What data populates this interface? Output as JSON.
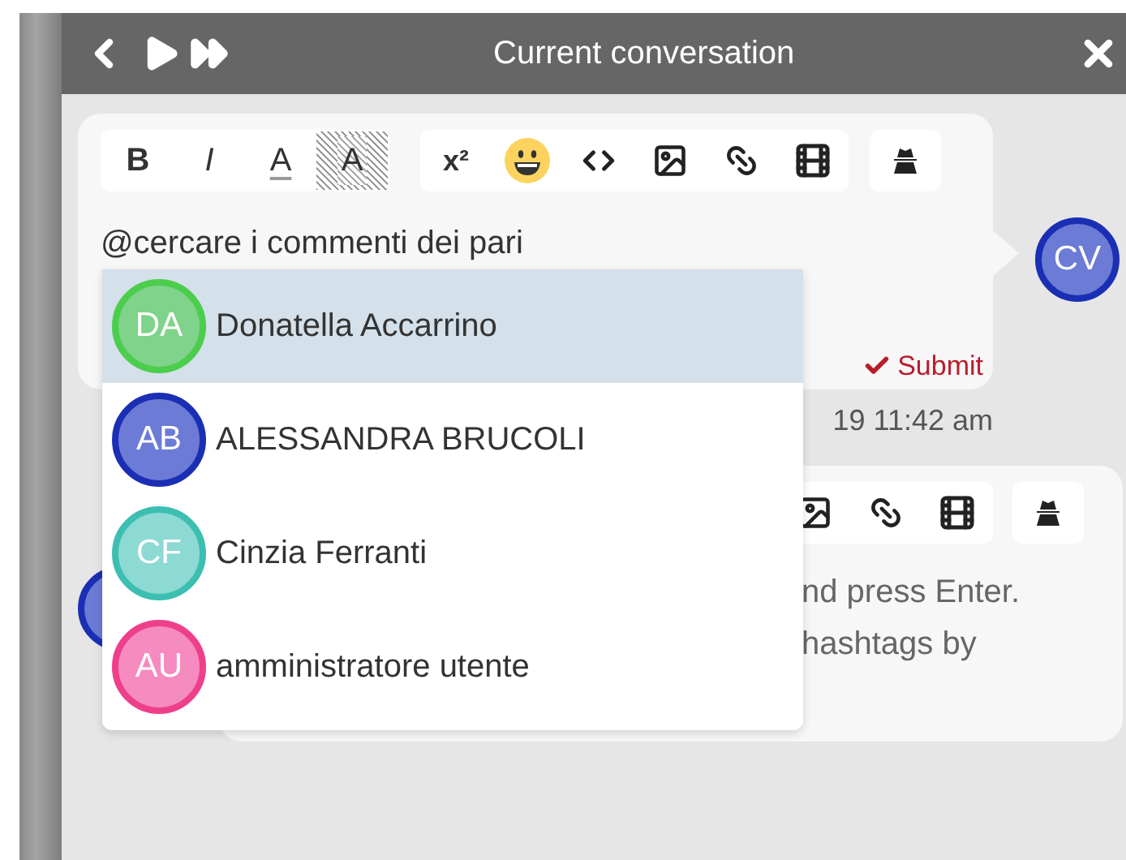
{
  "header": {
    "title": "Current conversation"
  },
  "composer": {
    "format_buttons": [
      {
        "label": "B",
        "kind": "bold"
      },
      {
        "label": "I",
        "kind": "italic"
      },
      {
        "label": "A",
        "kind": "color"
      },
      {
        "label": "A",
        "kind": "highlight"
      }
    ],
    "insert_buttons": [
      {
        "label": "x²",
        "kind": "text"
      },
      {
        "kind": "emoji"
      },
      {
        "kind": "code"
      },
      {
        "kind": "image"
      },
      {
        "kind": "link"
      },
      {
        "kind": "film"
      }
    ],
    "text": "@cercare i commenti dei pari",
    "submit": "Submit",
    "avatar": {
      "initials": "CV",
      "color": "#6b7bd6"
    }
  },
  "timestamp": "19 11:42 am",
  "second_card": {
    "lines": [
      "nd press Enter.",
      "hashtags by"
    ],
    "avatar": {
      "color": "#6b7bd6"
    }
  },
  "mentions": [
    {
      "initials": "DA",
      "name": "Donatella Accarrino",
      "color": "#7fd38b",
      "selected": true
    },
    {
      "initials": "AB",
      "name": "ALESSANDRA BRUCOLI",
      "color": "#6b7bd6",
      "selected": false
    },
    {
      "initials": "CF",
      "name": "Cinzia Ferranti",
      "color": "#8dd9d3",
      "selected": false
    },
    {
      "initials": "AU",
      "name": "amministratore utente",
      "color": "#f58bbf",
      "selected": false
    }
  ]
}
